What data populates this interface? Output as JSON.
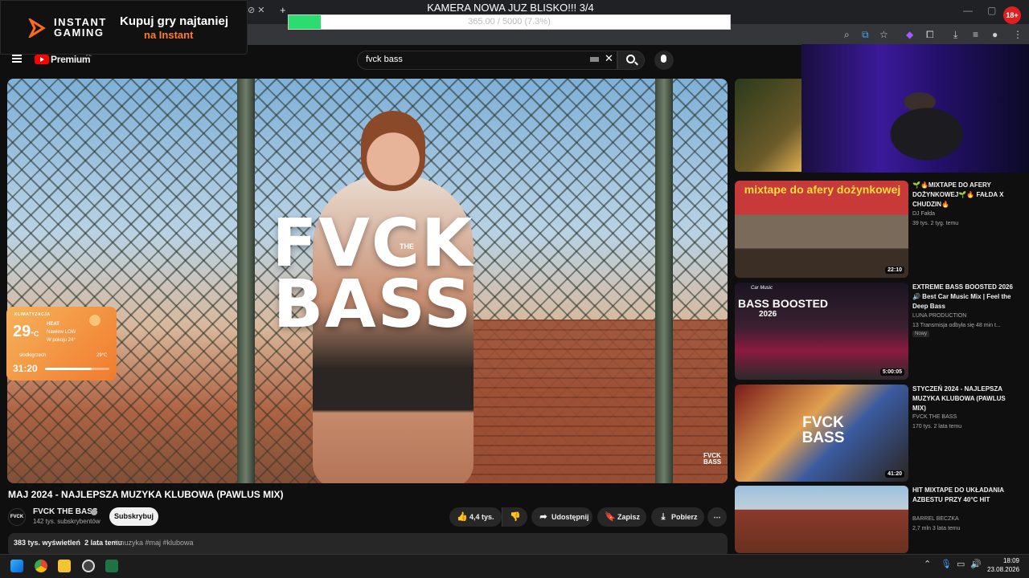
{
  "overlay": {
    "banner": {
      "brand_line1": "INSTANT",
      "brand_line2": "GAMING",
      "promo_line1": "Kupuj gry najtaniej",
      "promo_line2": "na Instant"
    },
    "goal": {
      "title": "KAMERA NOWA JUZ BLISKO!!! 3/4",
      "text": "365.00 / 5000 (7.3%)",
      "progress_percent": 7.3
    },
    "age_badge": "18+"
  },
  "youtube": {
    "brand": "Premium",
    "brand_region": "PL",
    "search": {
      "value": "fvck bass"
    },
    "player": {
      "thumb_title_line1": "FVCK",
      "thumb_title_line2": "BASS",
      "thumb_the": "THE",
      "watermark": "FVCK BASS"
    },
    "video": {
      "title": "MAJ 2024 - NAJLEPSZA MUZYKA KLUBOWA (PAWLUS MIX)",
      "channel": "FVCK THE BASS",
      "channel_avatar": "FVCK",
      "subscribers": "142 tys. subskrybentów",
      "subscribe_label": "Subskrybuj",
      "likes": "4,4 tys.",
      "share_label": "Udostępnij",
      "save_label": "Zapisz",
      "download_label": "Pobierz",
      "views": "383 tys. wyświetleń",
      "age": "2 lata temu",
      "hashtags": "#muzyka #maj #klubowa"
    },
    "sidebar": [
      {
        "title": "🌱🔥MIXTAPE DO AFERY DOŻYNKOWEJ🌱🔥 FAŁDA X CHUDZIN🔥",
        "channel": "DJ Fałda",
        "meta": "39 tys.   2 tyg. temu",
        "duration": "22:10",
        "thumb_text": "mixtape do afery dożynkowej"
      },
      {
        "title": "EXTREME BASS BOOSTED 2026 🔊 Best Car Music Mix | Feel the Deep Bass",
        "channel": "LUNA PRODUCTION",
        "meta": "13   Transmisja odbyła się 48 min t...",
        "duration": "5:00:05",
        "badge": "Nowy",
        "thumb_text_small": "Car Music",
        "thumb_text": "BASS BOOSTED",
        "thumb_text_year": "2026"
      },
      {
        "title": "STYCZEŃ 2024 - NAJLEPSZA MUZYKA KLUBOWA (PAWLUS MIX)",
        "channel": "FVCK THE BASS",
        "meta": "170 tys.   2 lata temu",
        "duration": "41:20",
        "thumb_text": "FVCK BASS"
      },
      {
        "title": "HIT MIXTAPE DO UKŁADANIA AZBESTU PRZY 40°C HIT",
        "channel": "BARREL BECZKA",
        "meta": "2,7 mln   3 lata temu"
      }
    ]
  },
  "weather": {
    "header": "KLIMATYZACJA",
    "temperature": "29",
    "unit": "°C",
    "mode": "HEAT",
    "level": "Nawiew LOW",
    "room": "W pokoju 24°",
    "source": "słodkigrzech",
    "source_value": "29°C",
    "timer": "31:20",
    "timer_progress_percent": 72
  },
  "taskbar": {
    "time": "18:09",
    "date": "23.08.2026"
  },
  "colors": {
    "accent": "#ff0000",
    "goal_fill": "#2bdd6e",
    "promo_orange": "#ff7a2b",
    "weather_bg": "#f07b2e"
  }
}
